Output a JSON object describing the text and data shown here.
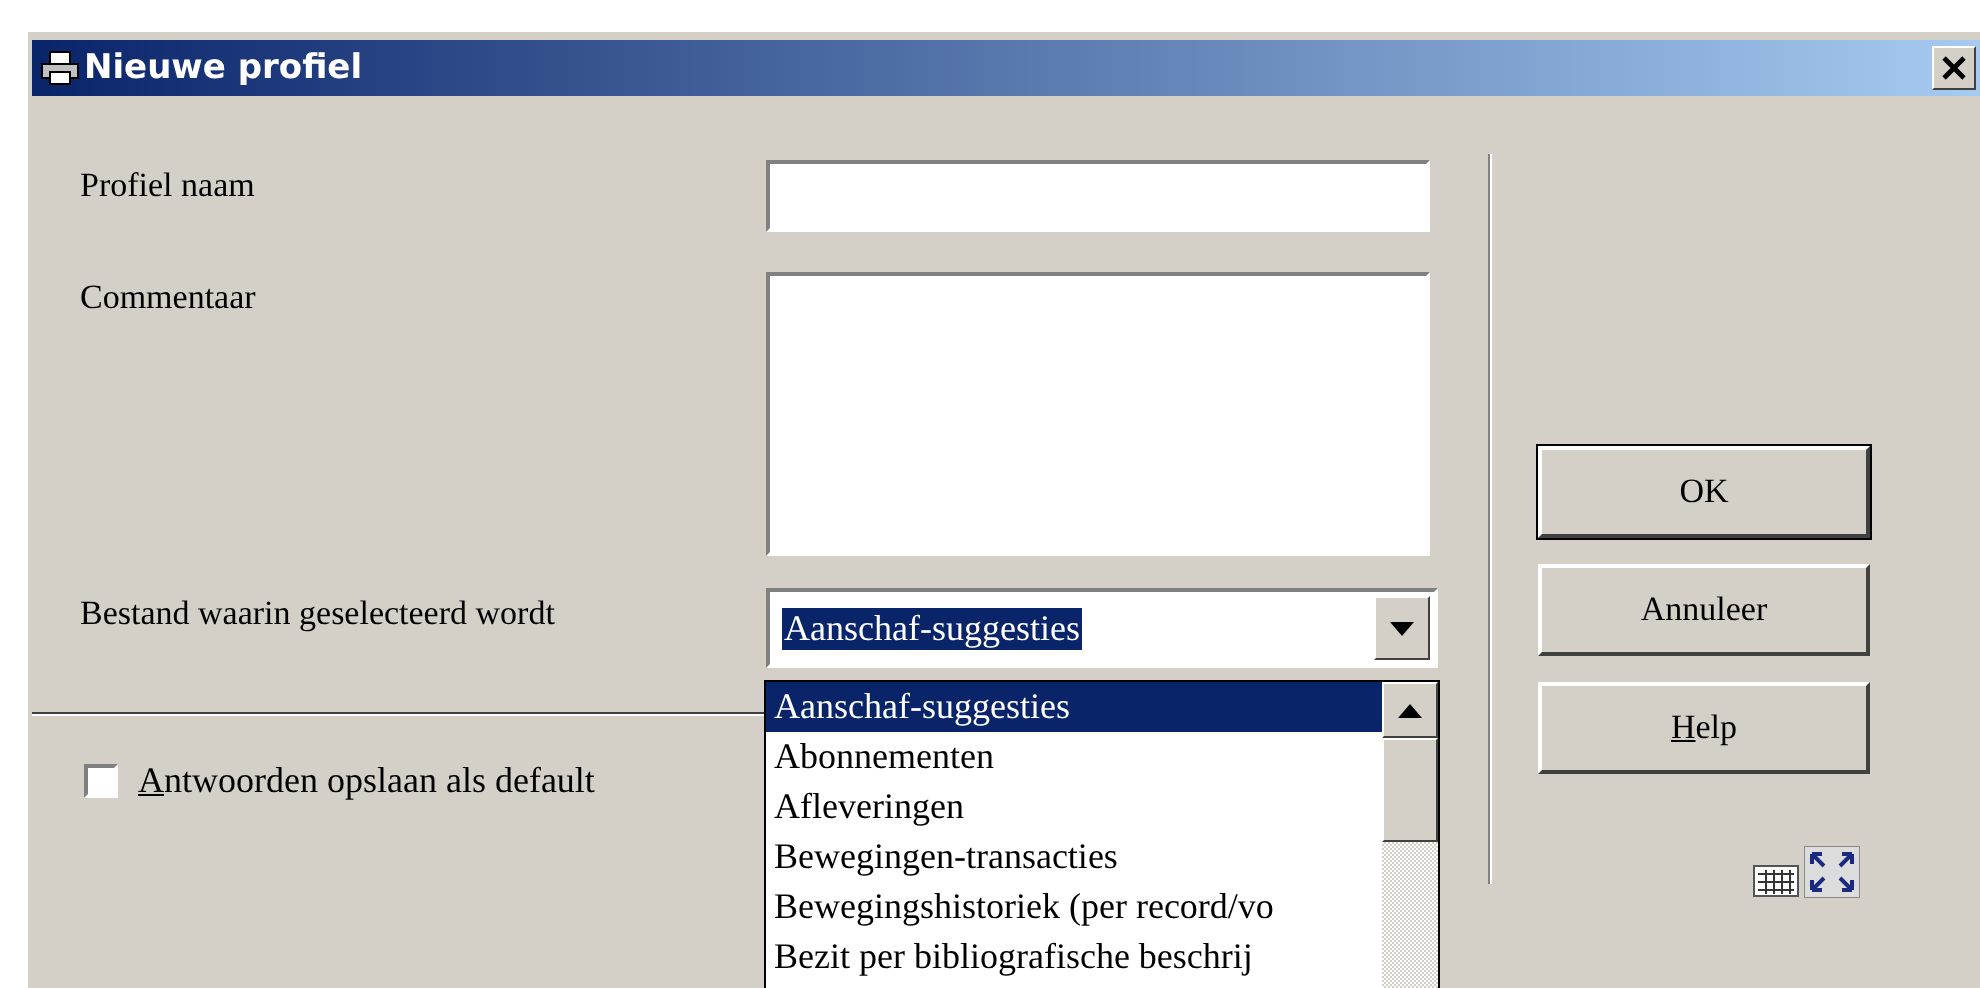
{
  "window": {
    "title": "Nieuwe profiel"
  },
  "fields": [
    {
      "kind": "input",
      "label": "Profiel naam"
    },
    {
      "kind": "textarea",
      "label": "Commentaar"
    }
  ],
  "file_select": {
    "label": "Bestand waarin geselecteerd wordt",
    "value": "Aanschaf-suggesties",
    "options": [
      {
        "label": "Aanschaf-suggesties",
        "selected": true
      },
      {
        "label": "Abonnementen",
        "selected": false
      },
      {
        "label": "Afleveringen",
        "selected": false
      },
      {
        "label": "Bewegingen-transacties",
        "selected": false
      },
      {
        "label": "Bewegingshistoriek (per record/vo",
        "selected": false
      },
      {
        "label": "Bezit per bibliografische beschrij",
        "selected": false
      }
    ]
  },
  "save_default": {
    "key": "A",
    "rest": "ntwoorden opslaan als default",
    "checked": false
  },
  "buttons": [
    {
      "label": "OK",
      "default": true
    },
    {
      "label": "Annuleer",
      "default": false
    },
    {
      "key": "H",
      "rest": "elp",
      "default": false
    }
  ]
}
